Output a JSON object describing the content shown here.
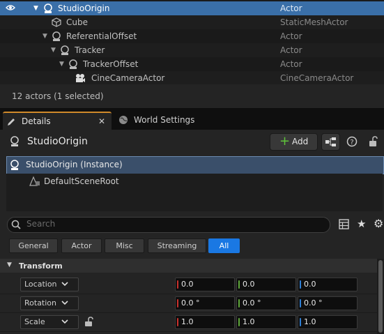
{
  "outliner": {
    "rows": [
      {
        "name": "StudioOrigin",
        "type": "Actor"
      },
      {
        "name": "Cube",
        "type": "StaticMeshActor"
      },
      {
        "name": "ReferentialOffset",
        "type": "Actor"
      },
      {
        "name": "Tracker",
        "type": "Actor"
      },
      {
        "name": "TrackerOffset",
        "type": "Actor"
      },
      {
        "name": "CineCameraActor",
        "type": "CineCameraActor"
      }
    ],
    "status": "12 actors (1 selected)"
  },
  "tabs": {
    "details": "Details",
    "world_settings": "World Settings"
  },
  "details": {
    "actor_name": "StudioOrigin",
    "add_label": "Add",
    "components": [
      "StudioOrigin (Instance)",
      "DefaultSceneRoot"
    ],
    "search_placeholder": "Search",
    "filters": [
      "General",
      "Actor",
      "Misc",
      "Streaming",
      "All"
    ],
    "active_filter": "All",
    "section_title": "Transform",
    "transform": [
      {
        "label": "Location",
        "x": "0.0",
        "y": "0.0",
        "z": "0.0"
      },
      {
        "label": "Rotation",
        "x": "0.0 °",
        "y": "0.0 °",
        "z": "0.0 °"
      },
      {
        "label": "Scale",
        "x": "1.0",
        "y": "1.0",
        "z": "1.0"
      }
    ]
  },
  "colors": {
    "selection": "#3a6fa8",
    "accent_tab": "#d08a2a",
    "filter_active": "#1a78e3",
    "axis_x": "#c8302c",
    "axis_y": "#5fa83a",
    "axis_z": "#2f7fd6"
  }
}
